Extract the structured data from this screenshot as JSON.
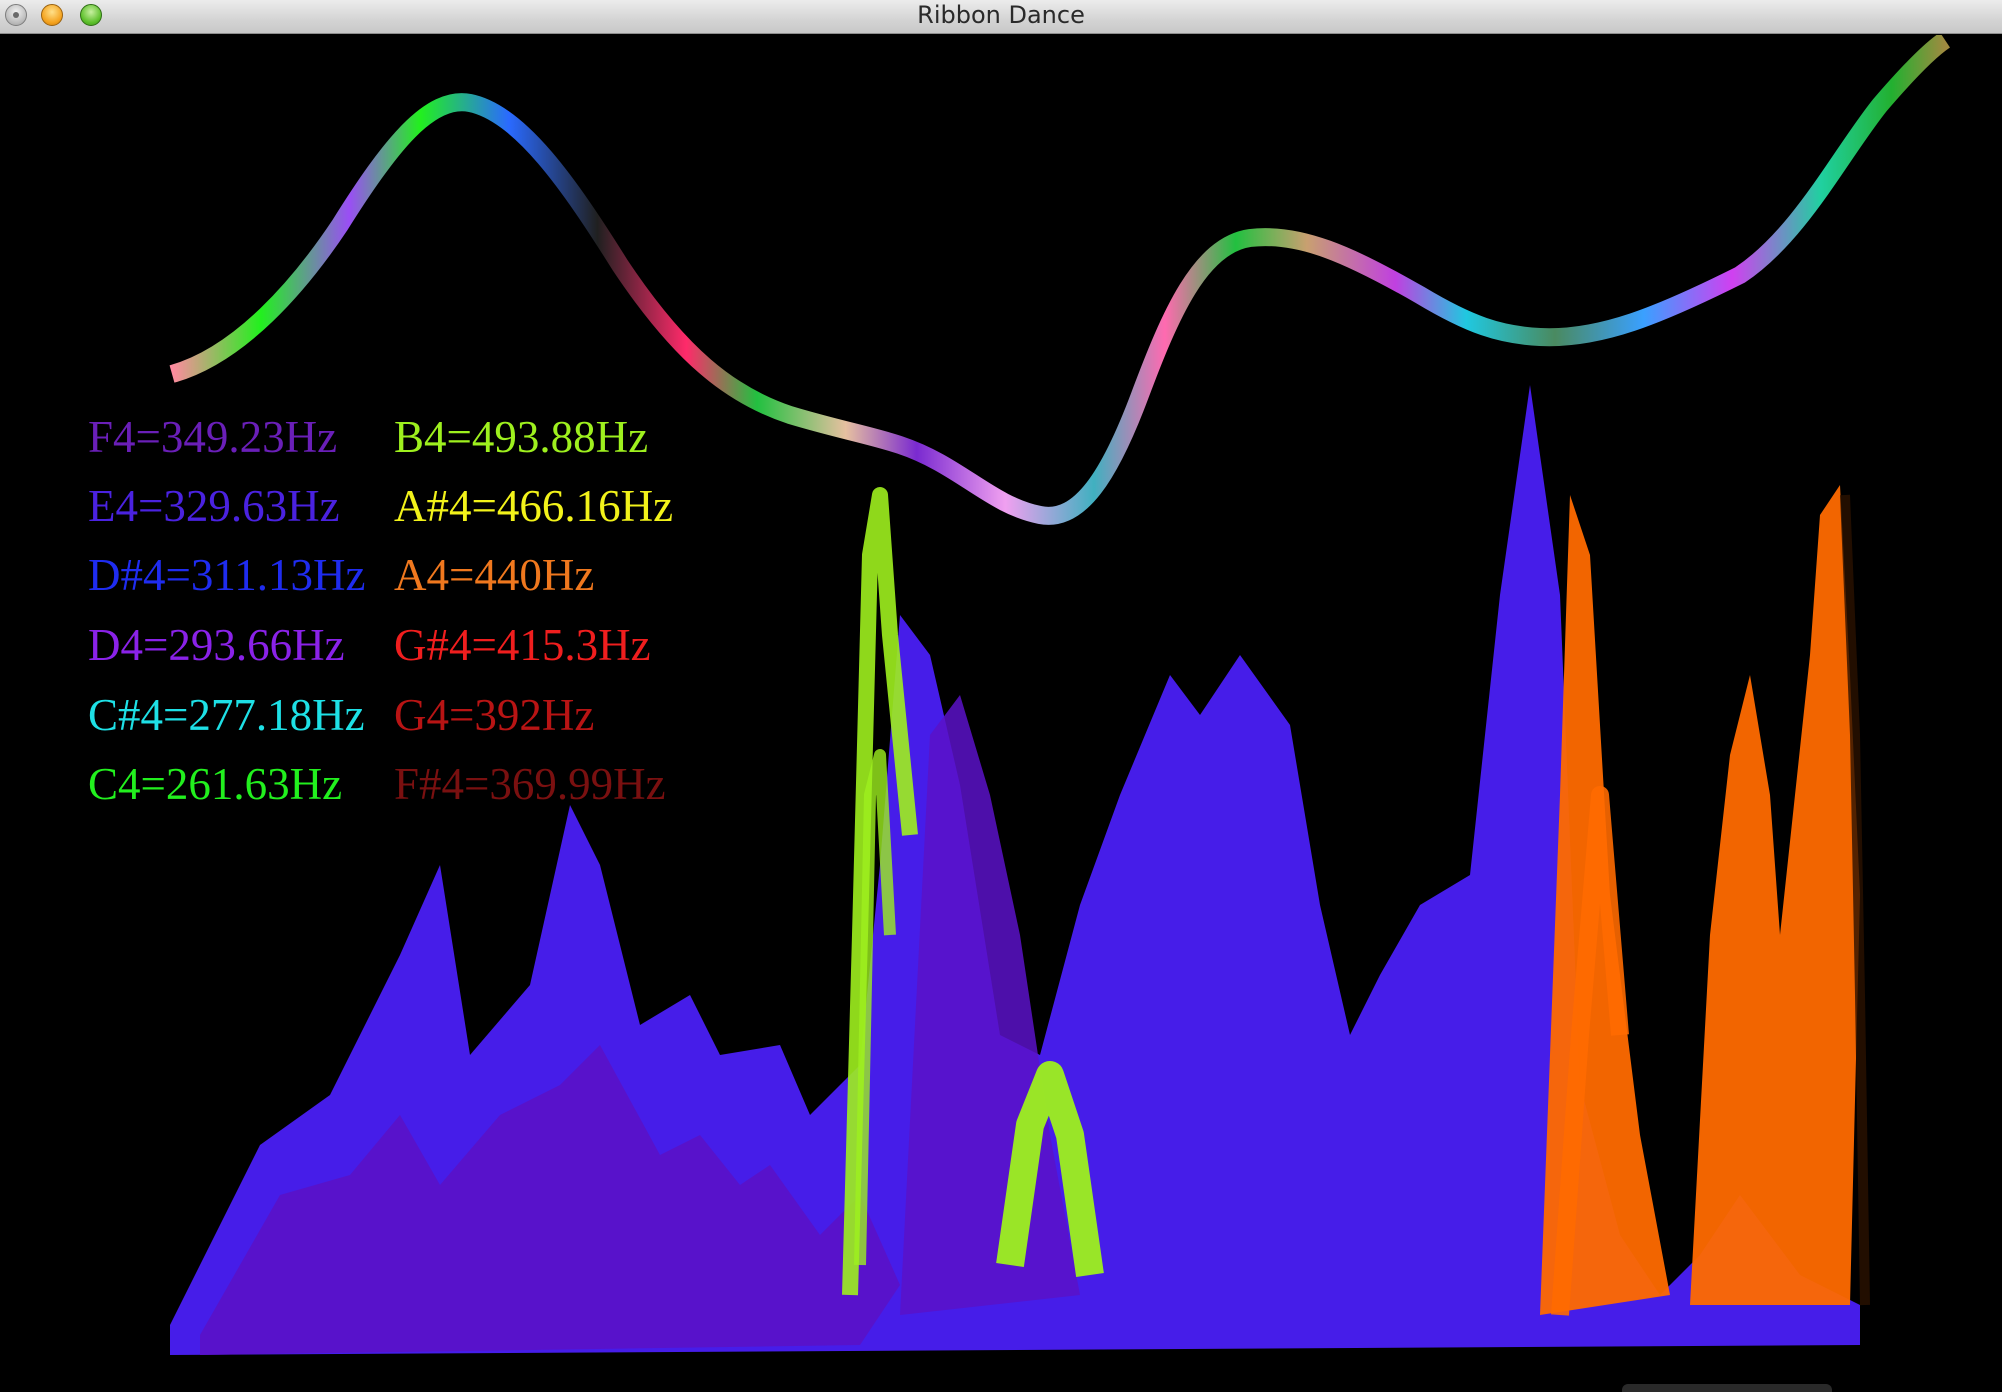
{
  "window": {
    "title": "Ribbon Dance"
  },
  "notes": {
    "left": [
      {
        "label": "F4=349.23Hz",
        "color": "#6a1fb8"
      },
      {
        "label": "E4=329.63Hz",
        "color": "#4a22e0"
      },
      {
        "label": "D#4=311.13Hz",
        "color": "#1f2cf0"
      },
      {
        "label": "D4=293.66Hz",
        "color": "#8a22e8"
      },
      {
        "label": "C#4=277.18Hz",
        "color": "#1ee0e6"
      },
      {
        "label": "C4=261.63Hz",
        "color": "#22f01e"
      }
    ],
    "right": [
      {
        "label": "B4=493.88Hz",
        "color": "#9ef01e"
      },
      {
        "label": "A#4=466.16Hz",
        "color": "#f2f21a"
      },
      {
        "label": "A4=440Hz",
        "color": "#f0781e"
      },
      {
        "label": "G#4=415.3Hz",
        "color": "#f01e1e"
      },
      {
        "label": "G4=392Hz",
        "color": "#b81414"
      },
      {
        "label": "F#4=369.99Hz",
        "color": "#7a1010"
      }
    ]
  },
  "colors": {
    "background": "#000000",
    "purple": "#5a12c8",
    "blue": "#4a1ff5",
    "lime": "#9ef01e",
    "orange": "#ff6a00"
  },
  "ribbon": {
    "palette": [
      "#22f01e",
      "#9a4ef5",
      "#2a2aff",
      "#e6e6e6",
      "#ff2a6a",
      "#20c8e0",
      "#f0a0f0",
      "#d040f0",
      "#ff8aa0"
    ]
  }
}
